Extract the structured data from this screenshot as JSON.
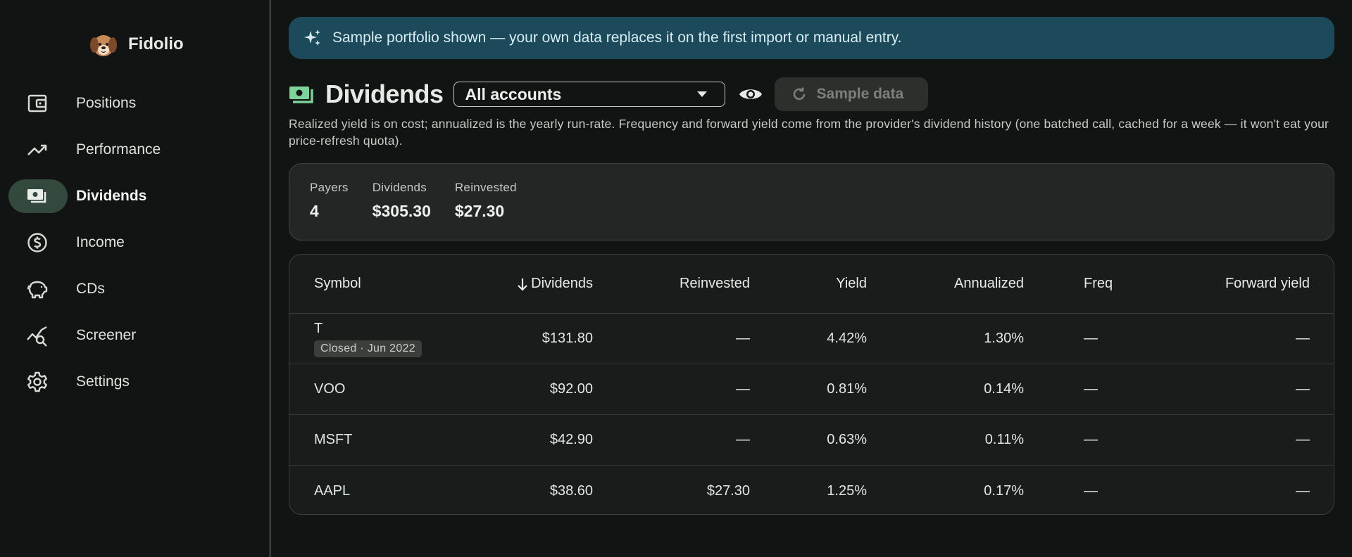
{
  "app": {
    "name": "Fidolio"
  },
  "sidebar": {
    "items": [
      {
        "label": "Positions",
        "icon": "wallet-icon",
        "active": false
      },
      {
        "label": "Performance",
        "icon": "trending-up-icon",
        "active": false
      },
      {
        "label": "Dividends",
        "icon": "cash-icon",
        "active": true
      },
      {
        "label": "Income",
        "icon": "dollar-circle-icon",
        "active": false
      },
      {
        "label": "CDs",
        "icon": "piggy-bank-icon",
        "active": false
      },
      {
        "label": "Screener",
        "icon": "chart-search-icon",
        "active": false
      },
      {
        "label": "Settings",
        "icon": "gear-icon",
        "active": false
      }
    ]
  },
  "banner": {
    "text": "Sample portfolio shown — your own data replaces it on the first import or manual entry.",
    "icon": "sparkle-icon"
  },
  "header": {
    "title": "Dividends",
    "account_select": "All accounts",
    "sample_button": "Sample data"
  },
  "description": "Realized yield is on cost; annualized is the yearly run-rate. Frequency and forward yield come from the provider's dividend history (one batched call, cached for a week — it won't eat your price-refresh quota).",
  "summary": {
    "payers_label": "Payers",
    "payers_value": "4",
    "dividends_label": "Dividends",
    "dividends_value": "$305.30",
    "reinvested_label": "Reinvested",
    "reinvested_value": "$27.30"
  },
  "table": {
    "headers": {
      "symbol": "Symbol",
      "dividends": "Dividends",
      "reinvested": "Reinvested",
      "yield": "Yield",
      "annualized": "Annualized",
      "freq": "Freq",
      "forward_yield": "Forward yield"
    },
    "rows": [
      {
        "symbol": "T",
        "badge": "Closed · Jun 2022",
        "dividends": "$131.80",
        "reinvested": "—",
        "yield": "4.42%",
        "annualized": "1.30%",
        "freq": "—",
        "forward_yield": "—"
      },
      {
        "symbol": "VOO",
        "dividends": "$92.00",
        "reinvested": "—",
        "yield": "0.81%",
        "annualized": "0.14%",
        "freq": "—",
        "forward_yield": "—"
      },
      {
        "symbol": "MSFT",
        "dividends": "$42.90",
        "reinvested": "—",
        "yield": "0.63%",
        "annualized": "0.11%",
        "freq": "—",
        "forward_yield": "—"
      },
      {
        "symbol": "AAPL",
        "dividends": "$38.60",
        "reinvested": "$27.30",
        "yield": "1.25%",
        "annualized": "0.17%",
        "freq": "—",
        "forward_yield": "—"
      }
    ]
  },
  "colors": {
    "accent": "#7fd39a",
    "active_pill": "#33493d",
    "banner": "#1c4a5a"
  }
}
